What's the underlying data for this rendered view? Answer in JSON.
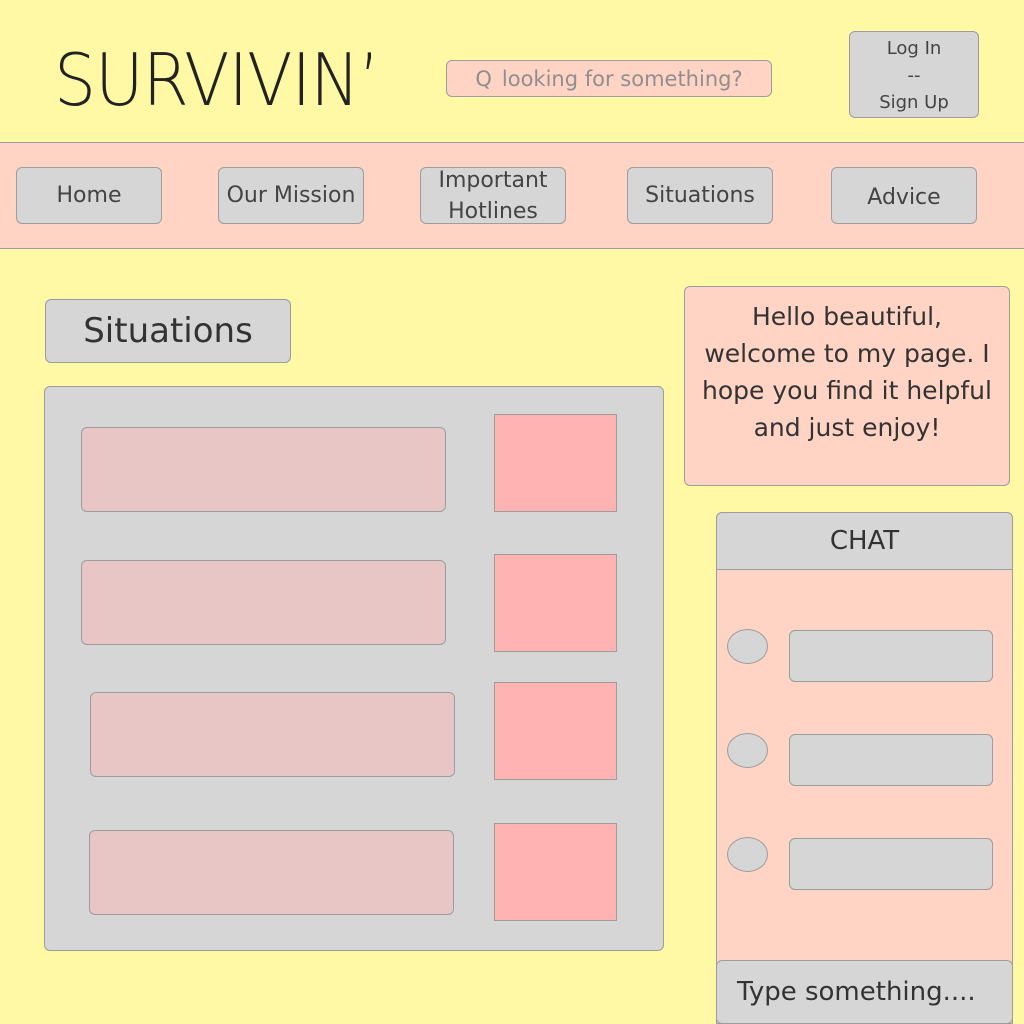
{
  "header": {
    "logo": "SURVIVIN’",
    "search_icon": "Q",
    "search_placeholder": "looking for something?",
    "login_label": "Log In",
    "login_separator": "--",
    "signup_label": "Sign Up"
  },
  "nav": {
    "home": "Home",
    "mission": "Our Mission",
    "hotlines_line1": "Important",
    "hotlines_line2": "Hotlines",
    "situations": "Situations",
    "advice": "Advice"
  },
  "main": {
    "section_title": "Situations",
    "situation_count": 4
  },
  "welcome": {
    "text": "Hello beautiful, welcome to my page. I hope you find it helpful and just enjoy!"
  },
  "chat": {
    "title": "CHAT",
    "message_count": 3,
    "input_placeholder": "Type something...."
  },
  "colors": {
    "background": "#fff9a6",
    "pink_panel": "#ffd4c4",
    "gray": "#d6d6d6",
    "card_pink": "#e8c6c5",
    "thumb_pink": "#ffb3b3"
  }
}
